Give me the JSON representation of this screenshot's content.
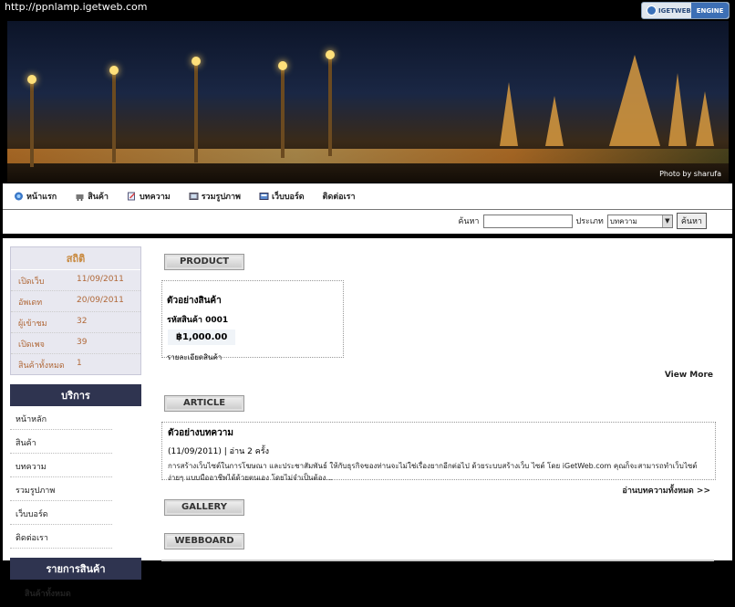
{
  "browser": {
    "url": "http://ppnlamp.igetweb.com"
  },
  "badge": {
    "left": "IGETWEB",
    "right": "ENGINE"
  },
  "banner": {
    "credit": "Photo by sharufa"
  },
  "nav": {
    "items": [
      {
        "label": "หน้าแรก",
        "icon": "home-icon"
      },
      {
        "label": "สินค้า",
        "icon": "cart-icon"
      },
      {
        "label": "บทความ",
        "icon": "article-icon"
      },
      {
        "label": "รวมรูปภาพ",
        "icon": "gallery-icon"
      },
      {
        "label": "เว็บบอร์ด",
        "icon": "webboard-icon"
      },
      {
        "label": "ติดต่อเรา",
        "icon": ""
      }
    ]
  },
  "search": {
    "label": "ค้นหา",
    "value": "",
    "type_label": "ประเภท",
    "type_selected": "บทความ",
    "button": "ค้นหา"
  },
  "stats": {
    "title": "สถิติ",
    "rows": [
      {
        "k": "เปิดเว็บ",
        "v": "11/09/2011"
      },
      {
        "k": "อัพเดท",
        "v": "20/09/2011"
      },
      {
        "k": "ผู้เข้าชม",
        "v": "32"
      },
      {
        "k": "เปิดเพจ",
        "v": "39"
      },
      {
        "k": "สินค้าทั้งหมด",
        "v": "1"
      }
    ]
  },
  "services": {
    "title": "บริการ",
    "items": [
      "หน้าหลัก",
      "สินค้า",
      "บทความ",
      "รวมรูปภาพ",
      "เว็บบอร์ด",
      "ติดต่อเรา"
    ]
  },
  "catalog": {
    "title": "รายการสินค้า",
    "all": "สินค้าทั้งหมด"
  },
  "sections": {
    "product": "PRODUCT",
    "article": "ARTICLE",
    "gallery": "GALLERY",
    "webboard": "WEBBOARD"
  },
  "product": {
    "name": "ตัวอย่างสินค้า",
    "code": "รหัสสินค้า 0001",
    "price": "฿1,000.00",
    "detail": "รายละเอียดสินค้า"
  },
  "view_more": "View More",
  "article": {
    "title": "ตัวอย่างบทความ",
    "meta": "(11/09/2011) | อ่าน 2 ครั้ง",
    "desc": "การสร้างเว็บไซต์ในการโฆษณา และประชาสัมพันธ์ ให้กับธุรกิจของท่านจะไม่ใช่เรื่องยากอีกต่อไป ด้วยระบบสร้างเว็บ ไซต์ โดย iGetWeb.com คุณก็จะสามารถทำเว็บไซต์ง่ายๆ แบบมืออาชีพได้ด้วยตนเอง โดยไม่จำเป็นต้อง...",
    "read_all": "อ่านบทความทั้งหมด >>"
  }
}
